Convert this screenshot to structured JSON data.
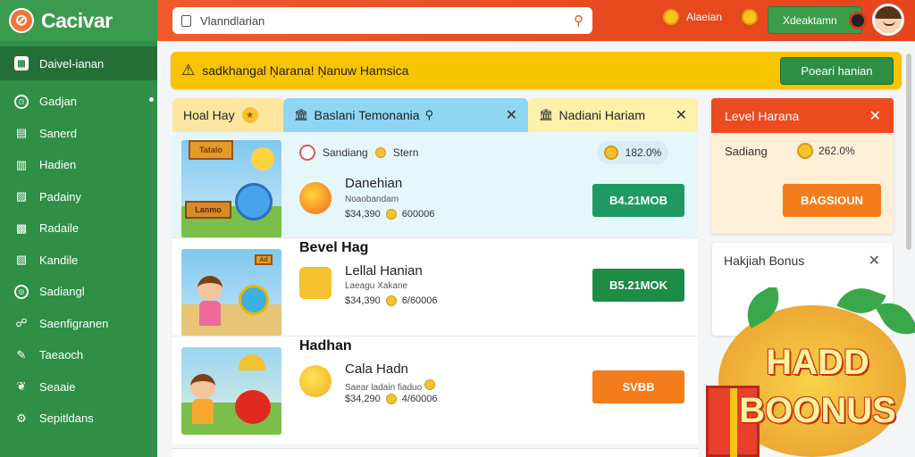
{
  "app": {
    "name": "Cacivar",
    "logo_glyph": "⊘"
  },
  "sidebar": {
    "items": [
      {
        "label": "Daivel-ianan",
        "icon": "grid-icon",
        "glyph": "▦",
        "active": true
      },
      {
        "label": "Gadjan",
        "icon": "clock-icon",
        "glyph": "◷"
      },
      {
        "label": "Sanerd",
        "icon": "cart-icon",
        "glyph": "▤"
      },
      {
        "label": "Hadien",
        "icon": "chart-icon",
        "glyph": "▥"
      },
      {
        "label": "Padainy",
        "icon": "bar-chart-icon",
        "glyph": "▨"
      },
      {
        "label": "Radaile",
        "icon": "calendar-icon",
        "glyph": "▩"
      },
      {
        "label": "Kandile",
        "icon": "list-icon",
        "glyph": "▧"
      },
      {
        "label": "Sadiangl",
        "icon": "target-icon",
        "glyph": "◎"
      },
      {
        "label": "Saenfigranen",
        "icon": "people-icon",
        "glyph": "☍"
      },
      {
        "label": "Taeaoch",
        "icon": "pen-icon",
        "glyph": "✎"
      },
      {
        "label": "Seaaie",
        "icon": "leaf-icon",
        "glyph": "❦"
      },
      {
        "label": "Sepitldans",
        "icon": "settings-icon",
        "glyph": "⚙"
      }
    ]
  },
  "header": {
    "search_value": "Vlanndlarian",
    "notif_label": "Alaeian",
    "button_label": "Xdeaktamn"
  },
  "banner": {
    "text": "sadkhangal Ņarana! Ņanuw Hamsica",
    "button": "Poeari hanian"
  },
  "tabs": [
    {
      "label": "Hoal Hay"
    },
    {
      "label": "Baslani Temonania"
    },
    {
      "label": "Nadiani Hariam"
    }
  ],
  "rows": [
    {
      "meta_label": "Sandiang",
      "meta_coin": "Stern",
      "pill": "182.0%",
      "title": "Danehian",
      "subtitle": "Noaobandam",
      "price": "$34,390",
      "coins": "600006",
      "action": "B4.21MOB",
      "sign_a": "Tatalo",
      "sign_b": "Lanmo"
    },
    {
      "section": "Bevel Hag",
      "title": "Lellal Hanian",
      "subtitle": "Laeagu Xakane",
      "price": "$34,390",
      "coins": "6/60006",
      "action": "B5.21MOK",
      "sign_a": "Ad"
    },
    {
      "section": "Hadhan",
      "title": "Cala Hadn",
      "subtitle": "Saear ladain fiaduo",
      "price": "$34,290",
      "coins": "4/60006",
      "action": "SVBB"
    }
  ],
  "level": {
    "title": "Level Harana",
    "row_label": "Sadiang",
    "value": "262.0%",
    "button": "BAGSIOUN"
  },
  "bonus": {
    "title": "Hakjiah Bonus",
    "promo_line1": "HADD",
    "promo_line2": "BOONUS"
  }
}
